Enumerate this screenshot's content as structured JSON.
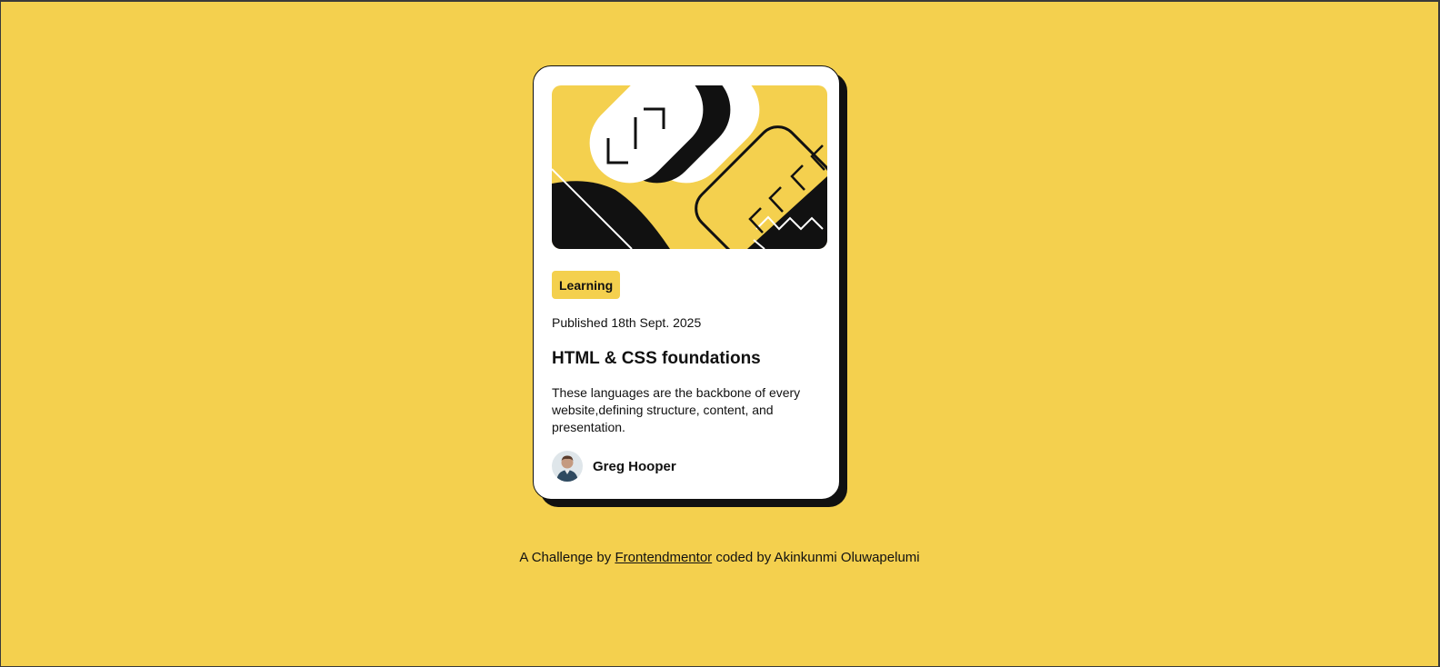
{
  "colors": {
    "background": "#F4D04E",
    "card": "#FFFFFF",
    "text": "#111111",
    "shadow": "#111111"
  },
  "card": {
    "illustration_icon": "abstract-code-illustration",
    "tag": "Learning",
    "published": "Published 18th Sept. 2025",
    "title": "HTML & CSS foundations",
    "description": "These languages are the backbone of every website,defining structure, content, and presentation.",
    "author": {
      "avatar_icon": "avatar-photo",
      "name": "Greg Hooper"
    }
  },
  "attribution": {
    "prefix": "A Challenge by ",
    "link": "Frontendmentor",
    "suffix": " coded by Akinkunmi Oluwapelumi"
  }
}
